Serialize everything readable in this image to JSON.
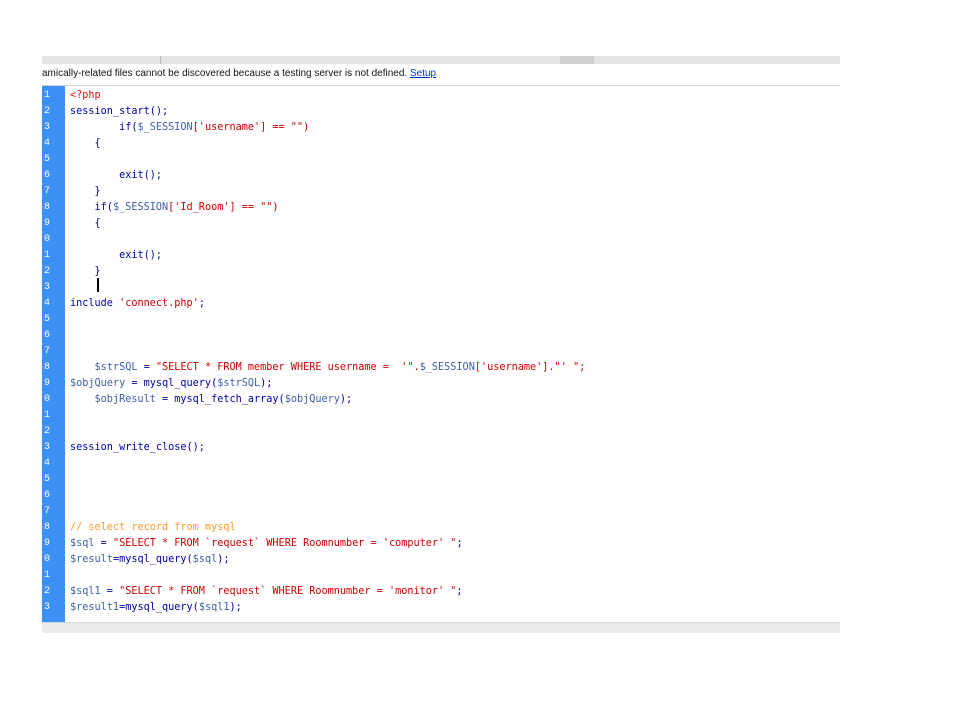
{
  "infobar": {
    "message": "amically-related files cannot be discovered because a testing server is not defined. ",
    "link": "Setup"
  },
  "editor": {
    "lines": [
      {
        "num": "1",
        "parts": [
          {
            "t": "<?php",
            "k": "tag"
          }
        ]
      },
      {
        "num": "2",
        "parts": [
          {
            "t": "session_start();",
            "k": "fn"
          }
        ]
      },
      {
        "num": "3",
        "parts": [
          {
            "t": "        if(",
            "k": "fn"
          },
          {
            "t": "$_SESSION",
            "k": "var"
          },
          {
            "t": "['username'] == \"\")",
            "k": "str"
          }
        ]
      },
      {
        "num": "4",
        "parts": [
          {
            "t": "    {",
            "k": "op"
          }
        ]
      },
      {
        "num": "5",
        "parts": []
      },
      {
        "num": "6",
        "parts": [
          {
            "t": "        exit();",
            "k": "fn"
          }
        ]
      },
      {
        "num": "7",
        "parts": [
          {
            "t": "    }",
            "k": "op"
          }
        ]
      },
      {
        "num": "8",
        "parts": [
          {
            "t": "    if(",
            "k": "fn"
          },
          {
            "t": "$_SESSION",
            "k": "var"
          },
          {
            "t": "['Id_Room'] == \"\")",
            "k": "str"
          }
        ]
      },
      {
        "num": "9",
        "parts": [
          {
            "t": "    {",
            "k": "op"
          }
        ]
      },
      {
        "num": "0",
        "parts": []
      },
      {
        "num": "1",
        "parts": [
          {
            "t": "        exit();",
            "k": "fn"
          }
        ]
      },
      {
        "num": "2",
        "parts": [
          {
            "t": "    }",
            "k": "op"
          }
        ]
      },
      {
        "num": "3",
        "parts": []
      },
      {
        "num": "4",
        "parts": [
          {
            "t": "include ",
            "k": "fn"
          },
          {
            "t": "'connect.php'",
            "k": "str"
          },
          {
            "t": ";",
            "k": "fn"
          }
        ]
      },
      {
        "num": "5",
        "parts": []
      },
      {
        "num": "6",
        "parts": []
      },
      {
        "num": "7",
        "parts": []
      },
      {
        "num": "8",
        "parts": [
          {
            "t": "    $strSQL",
            "k": "var"
          },
          {
            "t": " = ",
            "k": "op"
          },
          {
            "t": "\"SELECT * FROM member WHERE username =  '\".",
            "k": "str"
          },
          {
            "t": "$_SESSION",
            "k": "var"
          },
          {
            "t": "['username'].\"' \";",
            "k": "str"
          }
        ]
      },
      {
        "num": "9",
        "parts": [
          {
            "t": "$objQuery",
            "k": "var"
          },
          {
            "t": " = mysql_query(",
            "k": "fn"
          },
          {
            "t": "$strSQL",
            "k": "var"
          },
          {
            "t": ");",
            "k": "fn"
          }
        ]
      },
      {
        "num": "0",
        "parts": [
          {
            "t": "    $objResult",
            "k": "var"
          },
          {
            "t": " = mysql_fetch_array(",
            "k": "fn"
          },
          {
            "t": "$objQuery",
            "k": "var"
          },
          {
            "t": ");",
            "k": "fn"
          }
        ]
      },
      {
        "num": "1",
        "parts": []
      },
      {
        "num": "2",
        "parts": []
      },
      {
        "num": "3",
        "parts": [
          {
            "t": "session_write_close();",
            "k": "fn"
          }
        ]
      },
      {
        "num": "4",
        "parts": []
      },
      {
        "num": "5",
        "parts": []
      },
      {
        "num": "6",
        "parts": []
      },
      {
        "num": "7",
        "parts": []
      },
      {
        "num": "8",
        "parts": [
          {
            "t": "// select record from mysql",
            "k": "cmt"
          }
        ]
      },
      {
        "num": "9",
        "parts": [
          {
            "t": "$sql",
            "k": "var"
          },
          {
            "t": " = ",
            "k": "op"
          },
          {
            "t": "\"SELECT * FROM `request` WHERE Roomnumber = 'computer' \"",
            "k": "str"
          },
          {
            "t": ";",
            "k": "fn"
          }
        ]
      },
      {
        "num": "0",
        "parts": [
          {
            "t": "$result",
            "k": "var"
          },
          {
            "t": "=mysql_query(",
            "k": "fn"
          },
          {
            "t": "$sql",
            "k": "var"
          },
          {
            "t": ");",
            "k": "fn"
          }
        ]
      },
      {
        "num": "1",
        "parts": []
      },
      {
        "num": "2",
        "parts": [
          {
            "t": "$sql1",
            "k": "var"
          },
          {
            "t": " = ",
            "k": "op"
          },
          {
            "t": "\"SELECT * FROM `request` WHERE Roomnumber = 'monitor' \"",
            "k": "str"
          },
          {
            "t": ";",
            "k": "fn"
          }
        ]
      },
      {
        "num": "3",
        "parts": [
          {
            "t": "$result1",
            "k": "var"
          },
          {
            "t": "=mysql_query(",
            "k": "fn"
          },
          {
            "t": "$sql1",
            "k": "var"
          },
          {
            "t": ");",
            "k": "fn"
          }
        ]
      }
    ]
  },
  "colors": {
    "gutter": "#3d90f5",
    "tag": "#dd1111",
    "string": "#cc0000",
    "function": "#0000a6",
    "variable": "#3e5ea8",
    "comment": "#ff9a2e"
  }
}
